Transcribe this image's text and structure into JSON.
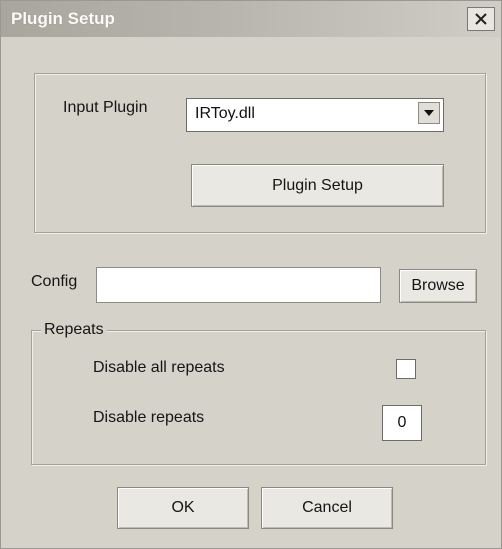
{
  "window": {
    "title": "Plugin Setup",
    "close_glyph": "✕"
  },
  "plugin_group": {
    "input_label": "Input Plugin",
    "selected_plugin": "IRToy.dll",
    "setup_button": "Plugin Setup"
  },
  "config": {
    "label": "Config",
    "value": "",
    "browse_button": "Browse"
  },
  "repeats": {
    "legend": "Repeats",
    "disable_all_label": "Disable all repeats",
    "disable_all_checked": false,
    "disable_label": "Disable repeats",
    "disable_value": "0"
  },
  "footer": {
    "ok_button": "OK",
    "cancel_button": "Cancel"
  }
}
